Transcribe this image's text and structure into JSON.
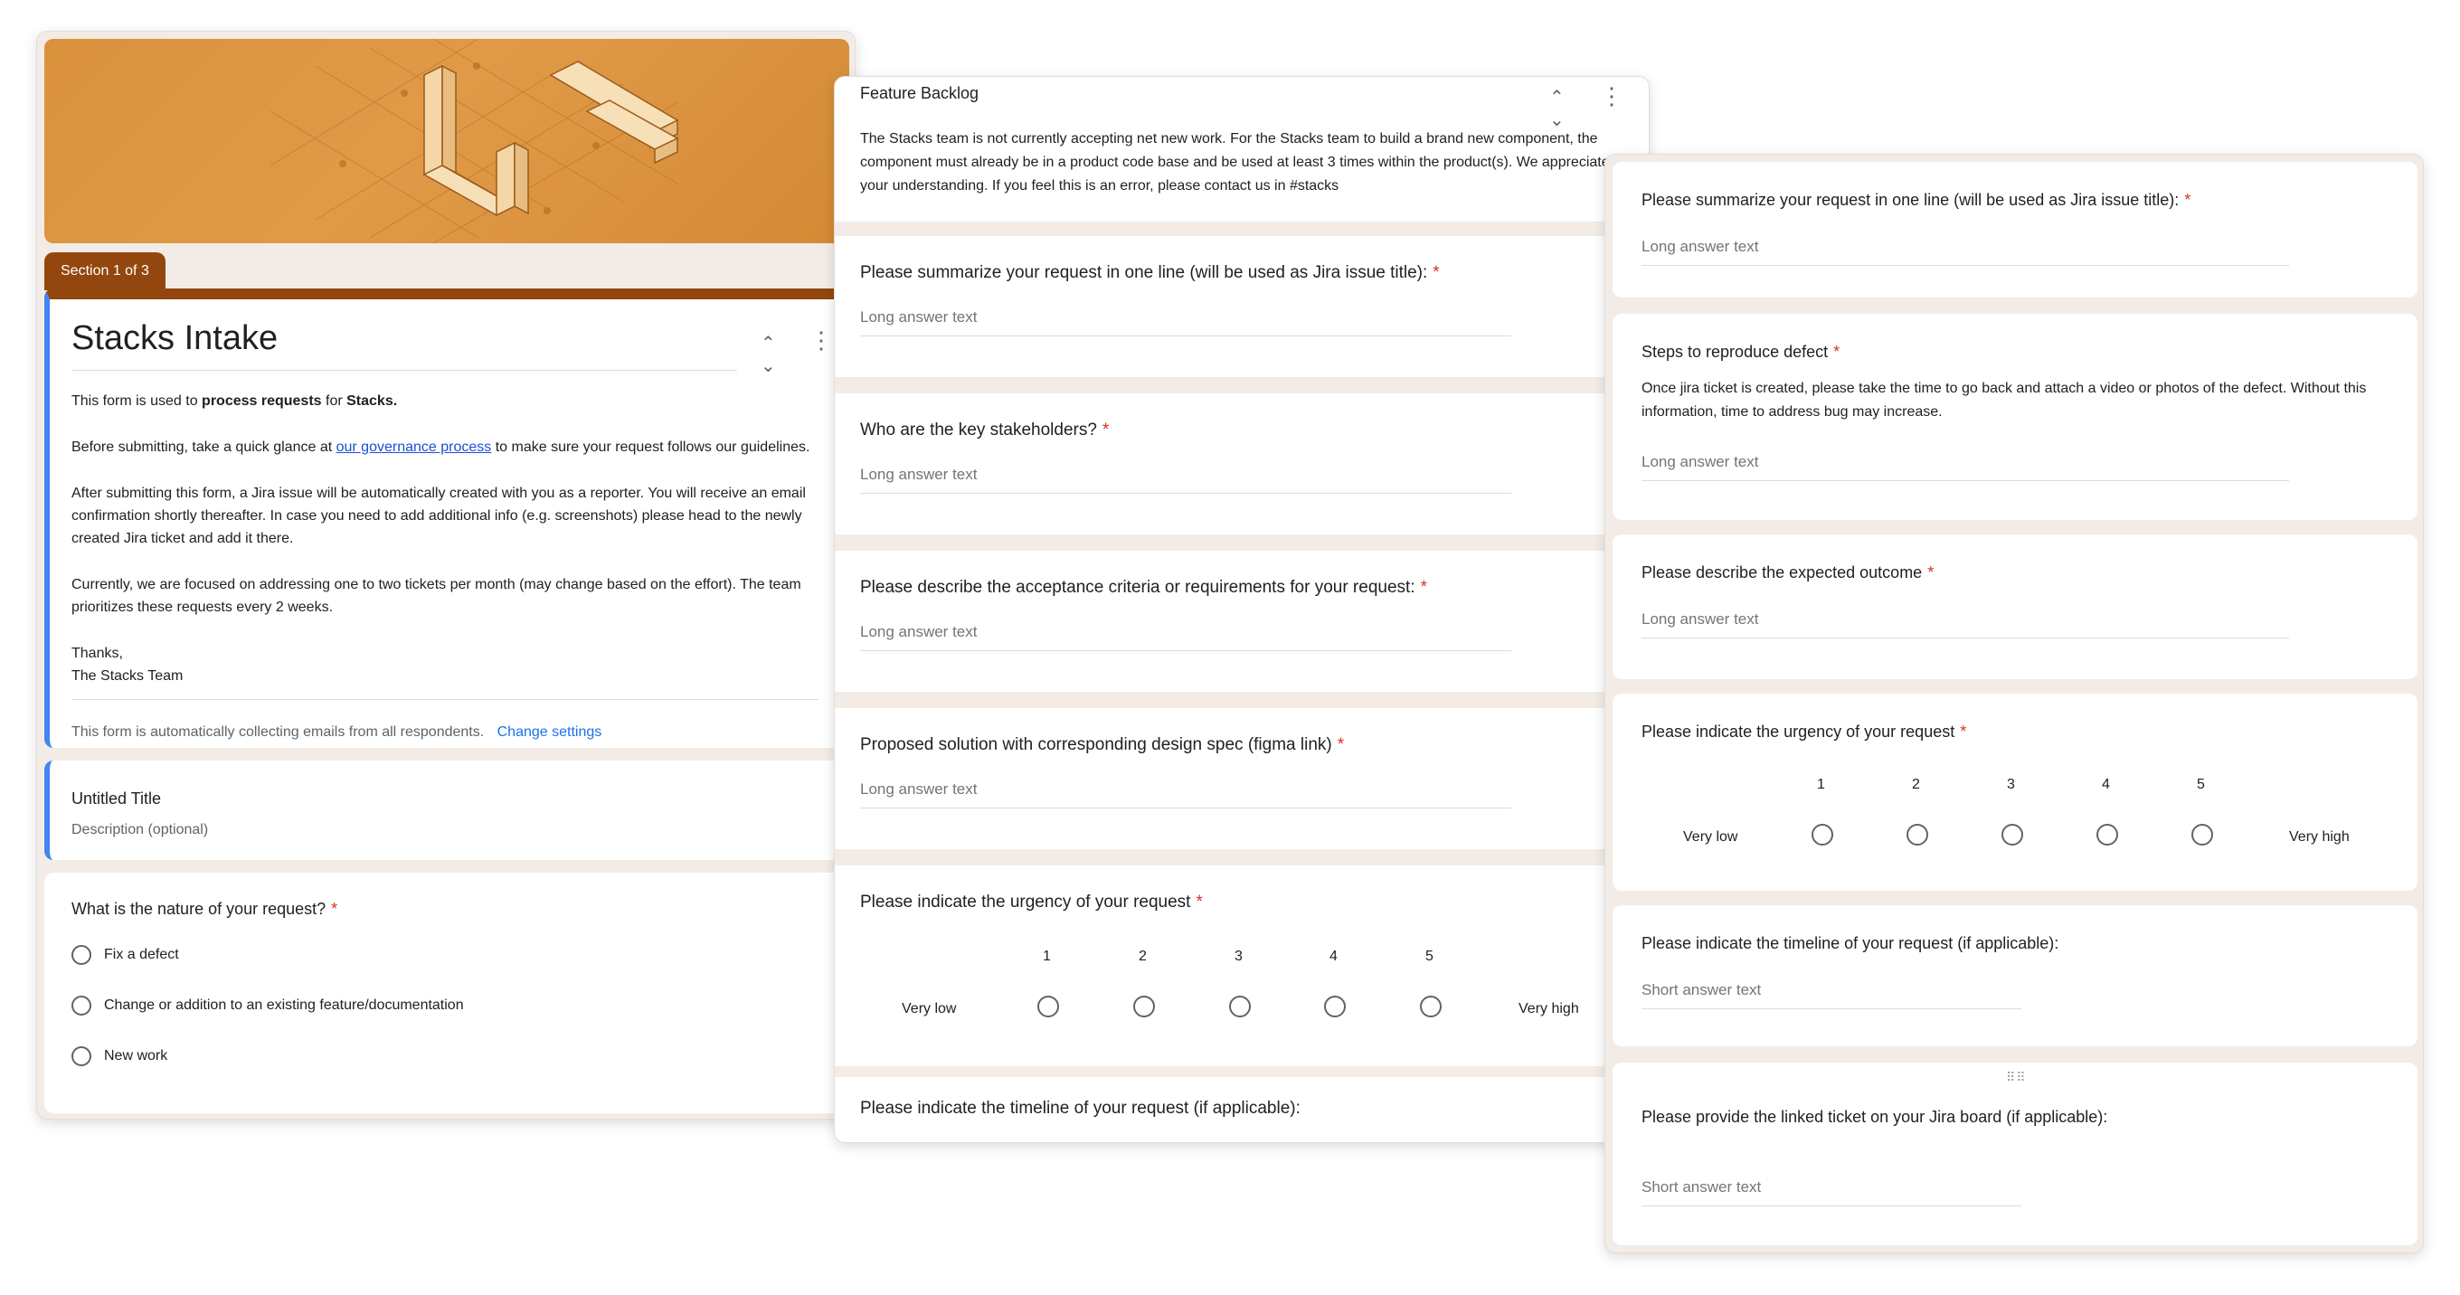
{
  "panel1": {
    "section_tab": "Section 1 of 3",
    "title": "Stacks Intake",
    "body": {
      "p1_prefix": "This form is used to ",
      "p1_bold1": "process requests",
      "p1_mid": " for ",
      "p1_bold2": "Stacks.",
      "p2_prefix": "Before submitting, take a quick glance at ",
      "p2_link": "our governance process",
      "p2_suffix": " to make sure your request follows our guidelines.",
      "p3": "After submitting this form, a Jira issue will be automatically created with you as a reporter. You will receive an email confirmation shortly thereafter. In case you need to add additional info (e.g. screenshots) please head to the newly created Jira ticket and add it there.",
      "p4": "Currently, we are focused on addressing one to two tickets per month (may change based on the effort). The team prioritizes these requests every 2 weeks.",
      "thanks": "Thanks,",
      "signoff": "The Stacks Team"
    },
    "footer_text": "This form is automatically collecting emails from all respondents.",
    "footer_link": "Change settings",
    "untitled_title": "Untitled Title",
    "untitled_desc": "Description (optional)",
    "nature_question": "What is the nature of your request?",
    "nature_options": [
      "Fix a defect",
      "Change or addition to an existing feature/documentation",
      "New work"
    ]
  },
  "panel2": {
    "title": "Feature Backlog",
    "description": "The Stacks team is not currently accepting net new work. For the Stacks team to build a brand new component, the component must already be in a product code base and be used at least 3 times within the product(s). We appreciate your understanding. If you feel this is an error, please contact us in #stacks",
    "q1": "Please summarize your request in one line (will be used as Jira issue title):",
    "q2": "Who are the key stakeholders?",
    "q3": "Please describe the acceptance criteria or requirements for your request:",
    "q4": "Proposed solution with corresponding design spec (figma link)",
    "q5": "Please indicate the urgency of your request",
    "q6": "Please indicate the timeline of your request (if applicable):",
    "long_placeholder": "Long answer text",
    "scale": {
      "numbers": [
        "1",
        "2",
        "3",
        "4",
        "5"
      ],
      "low": "Very low",
      "high": "Very high"
    }
  },
  "panel3": {
    "q1": "Please summarize your request in one line (will be used as Jira issue title):",
    "q2": "Steps to reproduce defect",
    "q2_desc": "Once jira ticket is created, please take the time to go back and attach a video or photos of the defect. Without this information, time to address bug may increase.",
    "q3": "Please describe the expected outcome",
    "q4": "Please indicate the urgency of your request",
    "q5": "Please indicate the timeline of your request (if applicable):",
    "q6": "Please provide the linked ticket on your Jira board (if applicable):",
    "long_placeholder": "Long answer text",
    "short_placeholder": "Short answer text",
    "scale": {
      "numbers": [
        "1",
        "2",
        "3",
        "4",
        "5"
      ],
      "low": "Very low",
      "high": "Very high"
    },
    "required_mark": "*"
  },
  "colors": {
    "accent": "#93470f",
    "banner": "#d9913c",
    "link": "#1a73e8",
    "required": "#d93025"
  }
}
